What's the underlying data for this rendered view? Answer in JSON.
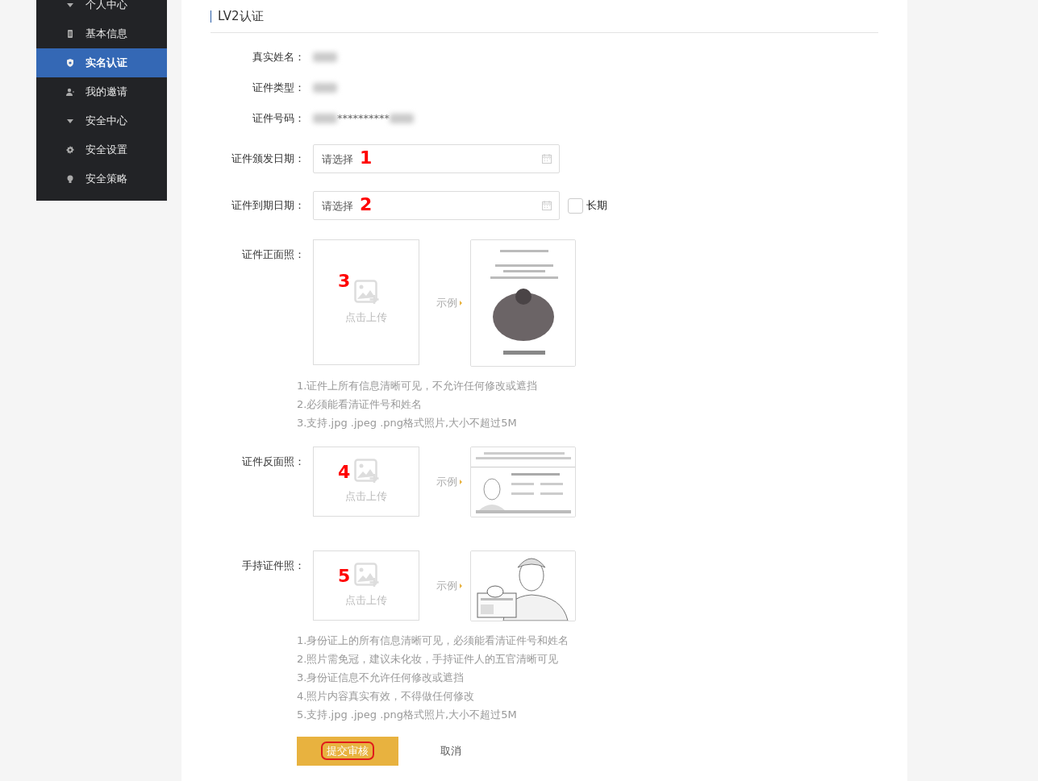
{
  "sidebar": {
    "items": [
      {
        "label": "个人中心",
        "kind": "group",
        "expanded": true,
        "children": [
          {
            "label": "基本信息",
            "selected": false
          },
          {
            "label": "实名认证",
            "selected": true
          },
          {
            "label": "我的邀请",
            "selected": false
          }
        ]
      },
      {
        "label": "安全中心",
        "kind": "group",
        "expanded": true,
        "children": [
          {
            "label": "安全设置",
            "selected": false
          },
          {
            "label": "安全策略",
            "selected": false
          }
        ]
      }
    ]
  },
  "title": "LV2认证",
  "info_rows": [
    {
      "label": "真实姓名：",
      "redacted": true
    },
    {
      "label": "证件类型：",
      "redacted": true
    },
    {
      "label": "证件号码：",
      "value": "**********",
      "redacted": true
    }
  ],
  "date_fields": [
    {
      "label": "证件颁发日期：",
      "placeholder": "请选择",
      "annotation": "1"
    },
    {
      "label": "证件到期日期：",
      "placeholder": "请选择",
      "annotation": "2",
      "checkbox": {
        "label": "长期",
        "checked": false
      }
    }
  ],
  "uploads": [
    {
      "label": "证件正面照：",
      "kind": "tall",
      "annotation": "3",
      "prompt": "点击上传",
      "example_label": "示例",
      "notes": [
        "1.证件上所有信息清晰可见，不允许任何修改或遮挡",
        "2.必须能看清证件号和姓名",
        "3.支持.jpg .jpeg .png格式照片,大小不超过5M"
      ]
    },
    {
      "label": "证件反面照：",
      "kind": "short",
      "annotation": "4",
      "prompt": "点击上传",
      "example_label": "示例"
    },
    {
      "label": "手持证件照：",
      "kind": "short",
      "annotation": "5",
      "prompt": "点击上传",
      "example_label": "示例",
      "notes": [
        "1.身份证上的所有信息清晰可见，必须能看清证件号和姓名",
        "2.照片需免冠，建议未化妆，手持证件人的五官清晰可见",
        "3.身份证信息不允许任何修改或遮挡",
        "4.照片内容真实有效，不得做任何修改",
        "5.支持.jpg .jpeg .png格式照片,大小不超过5M"
      ]
    }
  ],
  "buttons": [
    {
      "label": "提交审核",
      "kind": "primary",
      "circled": true
    },
    {
      "label": "取消",
      "kind": "plain",
      "circled": false
    }
  ]
}
